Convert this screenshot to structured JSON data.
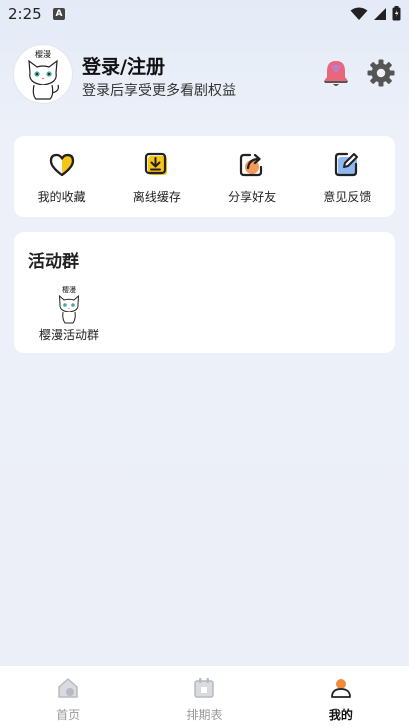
{
  "status_bar": {
    "time": "2:25",
    "notification_badge": "A",
    "icons": [
      "wifi-icon",
      "signal-icon",
      "battery-icon"
    ]
  },
  "profile": {
    "login_title": "登录/注册",
    "login_subtitle": "登录后享受更多看剧权益",
    "avatar_text": "樱漫",
    "icons": [
      "bell-icon",
      "gear-icon"
    ]
  },
  "quick_actions": [
    {
      "label": "我的收藏",
      "icon": "heart-icon"
    },
    {
      "label": "离线缓存",
      "icon": "download-icon"
    },
    {
      "label": "分享好友",
      "icon": "share-icon"
    },
    {
      "label": "意见反馈",
      "icon": "edit-icon"
    }
  ],
  "activity_group": {
    "title": "活动群",
    "items": [
      {
        "label": "樱漫活动群",
        "thumb_text": "樱漫",
        "icon": "cat-logo-icon"
      }
    ]
  },
  "bottom_nav": [
    {
      "label": "首页",
      "icon": "home-icon",
      "active": false
    },
    {
      "label": "排期表",
      "icon": "calendar-icon",
      "active": false
    },
    {
      "label": "我的",
      "icon": "profile-icon",
      "active": true
    }
  ],
  "colors": {
    "accent_yellow": "#f5c518",
    "active_orange": "#f28a3c",
    "bell_pink": "#e8677a"
  }
}
